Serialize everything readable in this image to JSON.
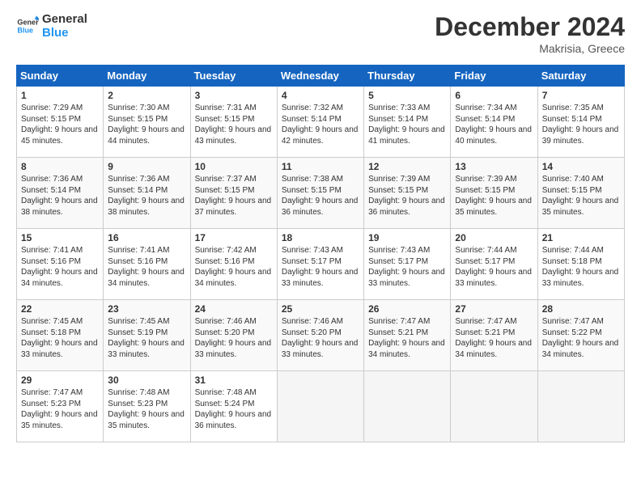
{
  "header": {
    "logo_line1": "General",
    "logo_line2": "Blue",
    "month": "December 2024",
    "location": "Makrisia, Greece"
  },
  "days_of_week": [
    "Sunday",
    "Monday",
    "Tuesday",
    "Wednesday",
    "Thursday",
    "Friday",
    "Saturday"
  ],
  "weeks": [
    [
      {
        "day": 1,
        "sunrise": "Sunrise: 7:29 AM",
        "sunset": "Sunset: 5:15 PM",
        "daylight": "Daylight: 9 hours and 45 minutes."
      },
      {
        "day": 2,
        "sunrise": "Sunrise: 7:30 AM",
        "sunset": "Sunset: 5:15 PM",
        "daylight": "Daylight: 9 hours and 44 minutes."
      },
      {
        "day": 3,
        "sunrise": "Sunrise: 7:31 AM",
        "sunset": "Sunset: 5:15 PM",
        "daylight": "Daylight: 9 hours and 43 minutes."
      },
      {
        "day": 4,
        "sunrise": "Sunrise: 7:32 AM",
        "sunset": "Sunset: 5:14 PM",
        "daylight": "Daylight: 9 hours and 42 minutes."
      },
      {
        "day": 5,
        "sunrise": "Sunrise: 7:33 AM",
        "sunset": "Sunset: 5:14 PM",
        "daylight": "Daylight: 9 hours and 41 minutes."
      },
      {
        "day": 6,
        "sunrise": "Sunrise: 7:34 AM",
        "sunset": "Sunset: 5:14 PM",
        "daylight": "Daylight: 9 hours and 40 minutes."
      },
      {
        "day": 7,
        "sunrise": "Sunrise: 7:35 AM",
        "sunset": "Sunset: 5:14 PM",
        "daylight": "Daylight: 9 hours and 39 minutes."
      }
    ],
    [
      {
        "day": 8,
        "sunrise": "Sunrise: 7:36 AM",
        "sunset": "Sunset: 5:14 PM",
        "daylight": "Daylight: 9 hours and 38 minutes."
      },
      {
        "day": 9,
        "sunrise": "Sunrise: 7:36 AM",
        "sunset": "Sunset: 5:14 PM",
        "daylight": "Daylight: 9 hours and 38 minutes."
      },
      {
        "day": 10,
        "sunrise": "Sunrise: 7:37 AM",
        "sunset": "Sunset: 5:15 PM",
        "daylight": "Daylight: 9 hours and 37 minutes."
      },
      {
        "day": 11,
        "sunrise": "Sunrise: 7:38 AM",
        "sunset": "Sunset: 5:15 PM",
        "daylight": "Daylight: 9 hours and 36 minutes."
      },
      {
        "day": 12,
        "sunrise": "Sunrise: 7:39 AM",
        "sunset": "Sunset: 5:15 PM",
        "daylight": "Daylight: 9 hours and 36 minutes."
      },
      {
        "day": 13,
        "sunrise": "Sunrise: 7:39 AM",
        "sunset": "Sunset: 5:15 PM",
        "daylight": "Daylight: 9 hours and 35 minutes."
      },
      {
        "day": 14,
        "sunrise": "Sunrise: 7:40 AM",
        "sunset": "Sunset: 5:15 PM",
        "daylight": "Daylight: 9 hours and 35 minutes."
      }
    ],
    [
      {
        "day": 15,
        "sunrise": "Sunrise: 7:41 AM",
        "sunset": "Sunset: 5:16 PM",
        "daylight": "Daylight: 9 hours and 34 minutes."
      },
      {
        "day": 16,
        "sunrise": "Sunrise: 7:41 AM",
        "sunset": "Sunset: 5:16 PM",
        "daylight": "Daylight: 9 hours and 34 minutes."
      },
      {
        "day": 17,
        "sunrise": "Sunrise: 7:42 AM",
        "sunset": "Sunset: 5:16 PM",
        "daylight": "Daylight: 9 hours and 34 minutes."
      },
      {
        "day": 18,
        "sunrise": "Sunrise: 7:43 AM",
        "sunset": "Sunset: 5:17 PM",
        "daylight": "Daylight: 9 hours and 33 minutes."
      },
      {
        "day": 19,
        "sunrise": "Sunrise: 7:43 AM",
        "sunset": "Sunset: 5:17 PM",
        "daylight": "Daylight: 9 hours and 33 minutes."
      },
      {
        "day": 20,
        "sunrise": "Sunrise: 7:44 AM",
        "sunset": "Sunset: 5:17 PM",
        "daylight": "Daylight: 9 hours and 33 minutes."
      },
      {
        "day": 21,
        "sunrise": "Sunrise: 7:44 AM",
        "sunset": "Sunset: 5:18 PM",
        "daylight": "Daylight: 9 hours and 33 minutes."
      }
    ],
    [
      {
        "day": 22,
        "sunrise": "Sunrise: 7:45 AM",
        "sunset": "Sunset: 5:18 PM",
        "daylight": "Daylight: 9 hours and 33 minutes."
      },
      {
        "day": 23,
        "sunrise": "Sunrise: 7:45 AM",
        "sunset": "Sunset: 5:19 PM",
        "daylight": "Daylight: 9 hours and 33 minutes."
      },
      {
        "day": 24,
        "sunrise": "Sunrise: 7:46 AM",
        "sunset": "Sunset: 5:20 PM",
        "daylight": "Daylight: 9 hours and 33 minutes."
      },
      {
        "day": 25,
        "sunrise": "Sunrise: 7:46 AM",
        "sunset": "Sunset: 5:20 PM",
        "daylight": "Daylight: 9 hours and 33 minutes."
      },
      {
        "day": 26,
        "sunrise": "Sunrise: 7:47 AM",
        "sunset": "Sunset: 5:21 PM",
        "daylight": "Daylight: 9 hours and 34 minutes."
      },
      {
        "day": 27,
        "sunrise": "Sunrise: 7:47 AM",
        "sunset": "Sunset: 5:21 PM",
        "daylight": "Daylight: 9 hours and 34 minutes."
      },
      {
        "day": 28,
        "sunrise": "Sunrise: 7:47 AM",
        "sunset": "Sunset: 5:22 PM",
        "daylight": "Daylight: 9 hours and 34 minutes."
      }
    ],
    [
      {
        "day": 29,
        "sunrise": "Sunrise: 7:47 AM",
        "sunset": "Sunset: 5:23 PM",
        "daylight": "Daylight: 9 hours and 35 minutes."
      },
      {
        "day": 30,
        "sunrise": "Sunrise: 7:48 AM",
        "sunset": "Sunset: 5:23 PM",
        "daylight": "Daylight: 9 hours and 35 minutes."
      },
      {
        "day": 31,
        "sunrise": "Sunrise: 7:48 AM",
        "sunset": "Sunset: 5:24 PM",
        "daylight": "Daylight: 9 hours and 36 minutes."
      },
      null,
      null,
      null,
      null
    ]
  ]
}
